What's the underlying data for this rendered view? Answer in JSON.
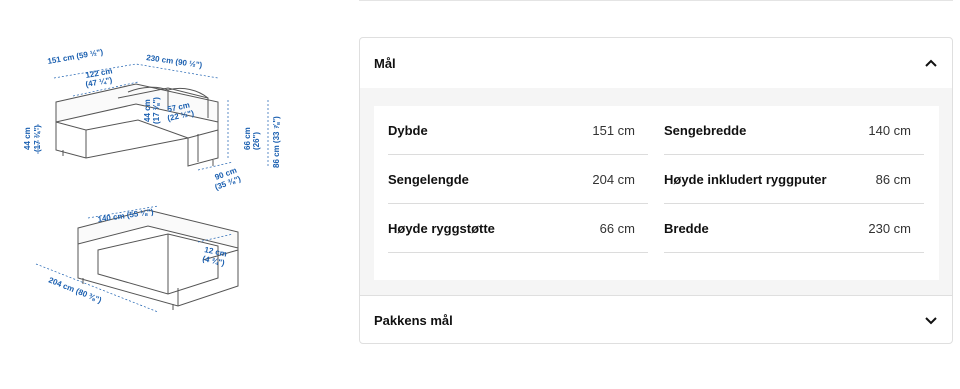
{
  "diagram": {
    "top_sofa": {
      "w_total": "151 cm (59 ½\")",
      "w_seat": "230 cm (90 ½\")",
      "depth_chaise": "122 cm",
      "depth_chaise_in": "(47 ¼\")",
      "seat_h": "44 cm",
      "seat_h_in": "(17 ¾\")",
      "seat_depth": "57 cm",
      "seat_depth_in": "(22 ½\")",
      "arm_h": "44 cm",
      "arm_h_in": "(17 ⅜\")",
      "back_h": "66 cm",
      "back_h_in": "(26\")",
      "total_h": "86 cm (33 ⅞\")",
      "depth": "90 cm",
      "depth_in": "(35 ⅜\")"
    },
    "bed": {
      "bed_w": "140 cm (55 ⅛\")",
      "gap": "12 cm",
      "gap_in": "(4 ¾\")",
      "bed_len": "204 cm (80 ⅜\")"
    }
  },
  "accordion": {
    "measurements": {
      "title": "Mål",
      "left": [
        {
          "label": "Dybde",
          "value": "151 cm"
        },
        {
          "label": "Sengelengde",
          "value": "204 cm"
        },
        {
          "label": "Høyde ryggstøtte",
          "value": "66 cm"
        }
      ],
      "right": [
        {
          "label": "Sengebredde",
          "value": "140 cm"
        },
        {
          "label": "Høyde inkludert ryggputer",
          "value": "86 cm"
        },
        {
          "label": "Bredde",
          "value": "230 cm"
        }
      ]
    },
    "package": {
      "title": "Pakkens mål"
    }
  },
  "icons": {
    "expanded": "chevron-up-icon",
    "collapsed": "chevron-down-icon"
  },
  "colors": {
    "dimension_text": "#1a5fb0",
    "panel_bg": "#f5f5f5"
  }
}
